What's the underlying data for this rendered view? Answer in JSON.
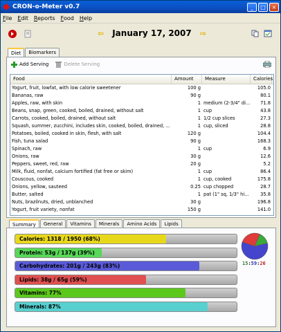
{
  "window": {
    "title": "CRON-o-Meter v0.7"
  },
  "menu": [
    "File",
    "Edit",
    "Reports",
    "Food",
    "Help"
  ],
  "date": "January 17, 2007",
  "main_tabs": [
    "Diet",
    "Biomarkers"
  ],
  "toolbar": {
    "add": "Add Serving",
    "delete": "Delete Serving"
  },
  "table": {
    "headers": [
      "Food",
      "Amount",
      "Measure",
      "Calories"
    ],
    "rows": [
      [
        "Yogurt, fruit, lowfat, with low calorie sweetener",
        "100 g",
        "",
        "105.0"
      ],
      [
        "Bananas, raw",
        "90 g",
        "",
        "80.1"
      ],
      [
        "Apples, raw, with skin",
        "1",
        "medium (2-3/4\" di...",
        "71.8"
      ],
      [
        "Beans, snap, green, cooked, boiled, drained, without salt",
        "1",
        "cup",
        "43.8"
      ],
      [
        "Carrots, cooked, boiled, drained, without salt",
        "1",
        "1/2 cup slices",
        "27.3"
      ],
      [
        "Squash, summer, zucchini, includes skin, cooked, boiled, drained, ...",
        "1",
        "cup, sliced",
        "28.8"
      ],
      [
        "Potatoes, boiled, cooked in skin, flesh, with salt",
        "120 g",
        "",
        "104.4"
      ],
      [
        "Fish, tuna salad",
        "90 g",
        "",
        "168.3"
      ],
      [
        "Spinach, raw",
        "1",
        "cup",
        "6.9"
      ],
      [
        "Onions, raw",
        "30 g",
        "",
        "12.6"
      ],
      [
        "Peppers, sweet, red, raw",
        "20 g",
        "",
        "5.2"
      ],
      [
        "Milk, fluid, nonfat, calcium fortified (fat free or skim)",
        "1",
        "cup",
        "86.4"
      ],
      [
        "Couscous, cooked",
        "1",
        "cup, cooked",
        "175.8"
      ],
      [
        "Onions, yellow, sauteed",
        "0.25",
        "cup chopped",
        "28.7"
      ],
      [
        "Butter, salted",
        "1",
        "pat (1\" sq, 1/3\" hi...",
        "35.8"
      ],
      [
        "Nuts, brazilnuts, dried, unblanched",
        "30 g",
        "",
        "196.8"
      ],
      [
        "Yogurt, fruit variety, nonfat",
        "150 g",
        "",
        "141.0"
      ]
    ]
  },
  "summary_tabs": [
    "Summary",
    "General",
    "Vitamins",
    "Minerals",
    "Amino Acids",
    "Lipids"
  ],
  "bars": [
    {
      "label": "Calories: 1318 / 1950 (68%)",
      "fraction": 0.68,
      "color": "#e8d81c"
    },
    {
      "label": "Protein: 53g / 137g (39%)",
      "fraction": 0.39,
      "color": "#58d858"
    },
    {
      "label": "Carbohydrates: 201g / 243g (83%)",
      "fraction": 0.83,
      "color": "#5a5ad8"
    },
    {
      "label": "Lipids: 38g / 65g (59%)",
      "fraction": 0.59,
      "color": "#e05050"
    },
    {
      "label": "Vitamins: 77%",
      "fraction": 0.77,
      "color": "#5cc81c"
    },
    {
      "label": "Minerals: 87%",
      "fraction": 0.87,
      "color": "#58d0d0"
    }
  ],
  "pie": {
    "slices": [
      {
        "value": 15,
        "color": "#3aa83a"
      },
      {
        "value": 59,
        "color": "#4444cc"
      },
      {
        "value": 26,
        "color": "#e03a3a"
      }
    ],
    "legend": [
      {
        "text": "15",
        "color": "#2c7a2c"
      },
      {
        "text": "59",
        "color": "#2c2ca8"
      },
      {
        "text": "26",
        "color": "#c02020"
      }
    ]
  }
}
